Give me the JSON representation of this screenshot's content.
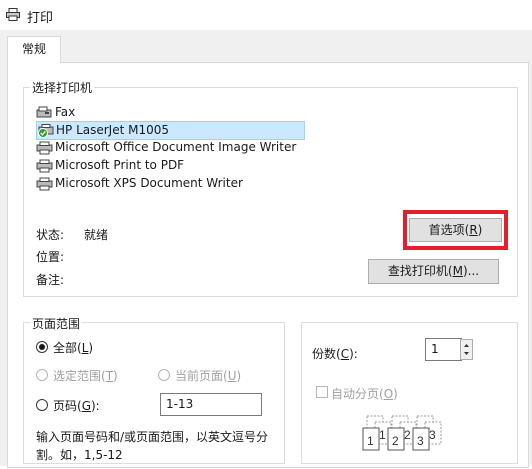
{
  "window": {
    "title": "打印"
  },
  "tabs": [
    {
      "label": "常规"
    }
  ],
  "select_printer": {
    "group_label": "选择打印机",
    "printers": [
      {
        "name": "Fax",
        "icon": "fax-icon",
        "selected": false
      },
      {
        "name": "HP LaserJet M1005",
        "icon": "printer-default-icon",
        "selected": true
      },
      {
        "name": "Microsoft Office Document Image Writer",
        "icon": "printer-icon",
        "selected": false
      },
      {
        "name": "Microsoft Print to PDF",
        "icon": "printer-icon",
        "selected": false
      },
      {
        "name": "Microsoft XPS Document Writer",
        "icon": "printer-icon",
        "selected": false
      }
    ],
    "status_label": "状态:",
    "status_value": "就绪",
    "location_label": "位置:",
    "comment_label": "备注:",
    "preferences_button": {
      "text": "首选项(",
      "key": "R",
      "suffix": ")"
    },
    "find_printer_button": {
      "text": "查找打印机(",
      "key": "M",
      "suffix": ")..."
    },
    "highlight_color": "#e0202a"
  },
  "page_range": {
    "group_label": "页面范围",
    "all": {
      "text": "全部(",
      "key": "L",
      "suffix": ")",
      "checked": true
    },
    "selection": {
      "text": "选定范围(",
      "key": "T",
      "suffix": ")",
      "enabled": false
    },
    "current_page": {
      "text": "当前页面(",
      "key": "U",
      "suffix": ")",
      "enabled": false
    },
    "pages": {
      "text": "页码(",
      "key": "G",
      "suffix": "):",
      "checked": false,
      "value": "1-13"
    },
    "hint_line1": "输入页面号码和/或页面范围，以英文逗号分",
    "hint_line2": "割。如，1,5-12"
  },
  "copies": {
    "label": "份数(",
    "key": "C",
    "suffix": "):",
    "value": "1",
    "collate": {
      "text": "自动分页(",
      "key": "O",
      "suffix": ")",
      "enabled": false
    }
  }
}
